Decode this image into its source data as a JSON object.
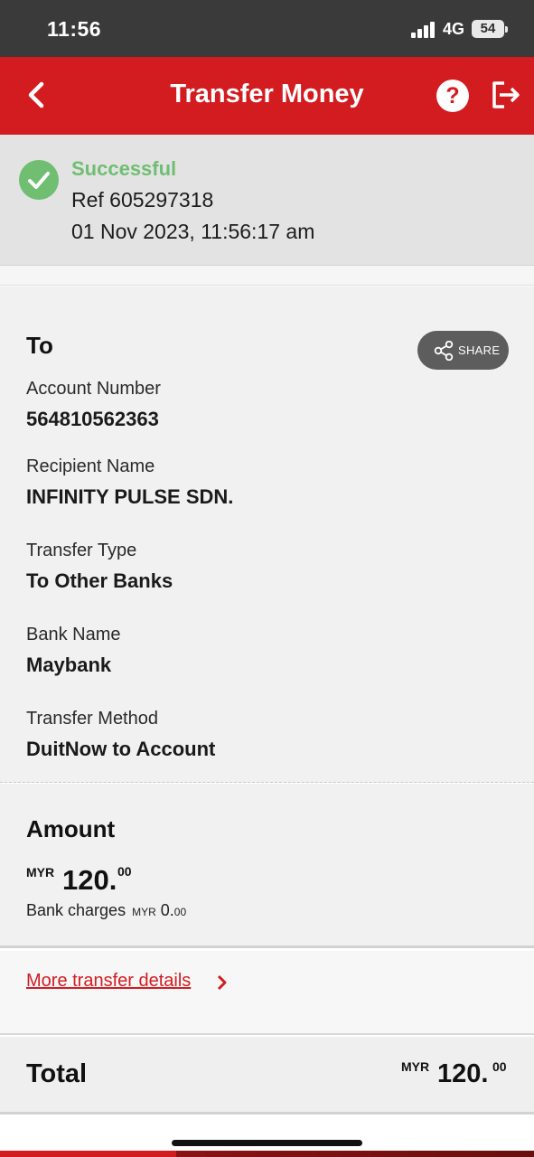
{
  "status_bar": {
    "time": "11:56",
    "network": "4G",
    "battery": "54"
  },
  "header": {
    "title": "Transfer Money",
    "help_label": "?"
  },
  "transaction_status": {
    "status": "Successful",
    "reference": "Ref 605297318",
    "datetime": "01 Nov 2023, 11:56:17 am"
  },
  "to_section": {
    "heading": "To",
    "share_label": "SHARE",
    "fields": [
      {
        "label": "Account Number",
        "value": "564810562363"
      },
      {
        "label": "Recipient Name",
        "value": "INFINITY PULSE SDN."
      },
      {
        "label": "Transfer Type",
        "value": "To Other Banks"
      },
      {
        "label": "Bank Name",
        "value": "Maybank"
      },
      {
        "label": "Transfer Method",
        "value": "DuitNow to Account"
      }
    ]
  },
  "amount_section": {
    "heading": "Amount",
    "currency": "MYR",
    "amount_whole": "120.",
    "amount_cents": "00",
    "charges_label": "Bank charges",
    "charges_currency": "MYR",
    "charges_whole": "0.",
    "charges_cents": "00"
  },
  "more_details": {
    "link_label": "More transfer details"
  },
  "total": {
    "label": "Total",
    "currency": "MYR",
    "amount_whole": "120.",
    "amount_cents": "00"
  },
  "colors": {
    "brand_red": "#d21c20",
    "success_green": "#6fbe72"
  }
}
